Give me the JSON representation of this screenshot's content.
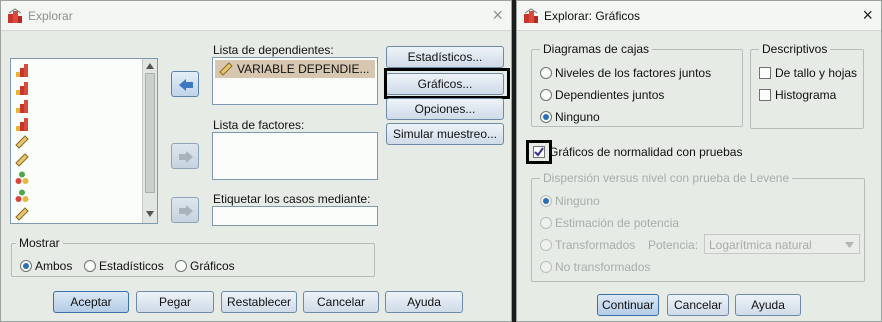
{
  "left_dialog": {
    "title": "Explorar",
    "close_glyph": "×",
    "dependents_label": "Lista de dependientes:",
    "dependent_item": "VARIABLE DEPENDIE...",
    "factors_label": "Lista de factores:",
    "label_cases_label": "Etiquetar los casos mediante:",
    "buttons": {
      "statistics": "Estadísticos...",
      "graphs": "Gráficos...",
      "options": "Opciones...",
      "simulate": "Simular muestreo..."
    },
    "source_variable_icons": [
      "bar-chart-icon",
      "bar-chart-icon",
      "bar-chart-icon",
      "bar-chart-icon",
      "ruler-icon",
      "ruler-icon",
      "nominal-icon",
      "nominal-icon",
      "ruler-icon"
    ],
    "show_group": {
      "legend": "Mostrar",
      "options": [
        "Ambos",
        "Estadísticos",
        "Gráficos"
      ],
      "selected": "Ambos"
    },
    "footer_buttons": {
      "ok": "Aceptar",
      "paste": "Pegar",
      "reset": "Restablecer",
      "cancel": "Cancelar",
      "help": "Ayuda"
    }
  },
  "right_dialog": {
    "title": "Explorar: Gráficos",
    "close_glyph": "×",
    "boxplots": {
      "legend": "Diagramas de cajas",
      "options": [
        "Niveles de los factores juntos",
        "Dependientes juntos",
        "Ninguno"
      ],
      "selected": "Ninguno"
    },
    "descriptives": {
      "legend": "Descriptivos",
      "stem_leaf": "De tallo y hojas",
      "histogram": "Histograma",
      "stem_leaf_checked": false,
      "histogram_checked": false
    },
    "normality_label": "Gráficos de normalidad con pruebas",
    "normality_checked": true,
    "levene": {
      "legend": "Dispersión versus nivel con prueba de Levene",
      "options": [
        "Ninguno",
        "Estimación de potencia",
        "Transformados",
        "No transformados"
      ],
      "power_label": "Potencia:",
      "power_value": "Logarítmica natural",
      "enabled": false
    },
    "footer_buttons": {
      "continue": "Continuar",
      "cancel": "Cancelar",
      "help": "Ayuda"
    }
  },
  "colors": {
    "dialog_bg": "#e6ebe6",
    "accent_blue": "#2b6fb5",
    "highlight": "#000000"
  }
}
